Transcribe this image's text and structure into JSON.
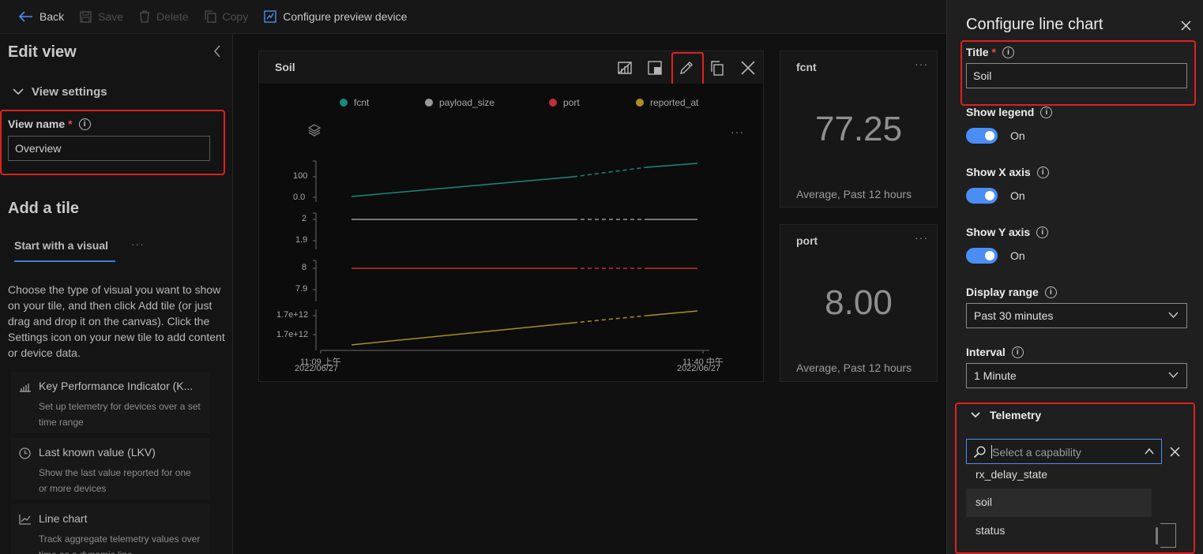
{
  "toolbar": {
    "back": "Back",
    "save": "Save",
    "delete": "Delete",
    "copy": "Copy",
    "configure": "Configure preview device"
  },
  "left_panel": {
    "title": "Edit view",
    "view_settings": "View settings",
    "view_name_label": "View name",
    "view_name_value": "Overview",
    "add_tile_title": "Add a tile",
    "tab_label": "Start with a visual",
    "tab_more": "···",
    "description": "Choose the type of visual you want to show on your tile, and then click Add tile (or just drag and drop it on the canvas). Click the Settings icon on your new tile to add content or device data.",
    "tiles": [
      {
        "title": "Key Performance Indicator (K...",
        "desc": "Set up telemetry for devices over a set time range",
        "icon": "kpi-icon"
      },
      {
        "title": "Last known value (LKV)",
        "desc": "Show the last value reported for one or more devices",
        "icon": "clock-icon"
      },
      {
        "title": "Line chart",
        "desc": "Track aggregate telemetry values over time as a dynamic line",
        "icon": "line-chart-icon"
      }
    ]
  },
  "chart_tile": {
    "title": "Soil",
    "more": "···"
  },
  "chart_data": {
    "type": "line",
    "title": "Soil",
    "legend_position": "top",
    "x_start": {
      "time": "11:09 上午",
      "date": "2022/06/27"
    },
    "x_end": {
      "time": "11:40 中午",
      "date": "2022/06/27"
    },
    "series": [
      {
        "name": "fcnt",
        "color": "#1a8a7a",
        "y_ticks": [
          "100",
          "0.0"
        ],
        "start": 0.0,
        "end": 120,
        "trend": "rising"
      },
      {
        "name": "payload_size",
        "color": "#9a9a9a",
        "y_ticks": [
          "2",
          "1.9"
        ],
        "start": 2,
        "end": 2,
        "trend": "flat"
      },
      {
        "name": "port",
        "color": "#c0303a",
        "y_ticks": [
          "8",
          "7.9"
        ],
        "start": 8,
        "end": 8,
        "trend": "flat"
      },
      {
        "name": "reported_at",
        "color": "#a89020",
        "y_ticks": [
          "1.7e+12",
          "1.7e+12"
        ],
        "start": 1700000000000.0,
        "end": 1700000000000.0,
        "trend": "rising"
      }
    ]
  },
  "kpis": [
    {
      "title": "fcnt",
      "value": "77.25",
      "sub": "Average, Past 12 hours",
      "more": "···"
    },
    {
      "title": "port",
      "value": "8.00",
      "sub": "Average, Past 12 hours",
      "more": "···"
    }
  ],
  "right_panel": {
    "title": "Configure line chart",
    "title_label": "Title",
    "title_value": "Soil",
    "show_legend": "Show legend",
    "show_x_axis": "Show X axis",
    "show_y_axis": "Show Y axis",
    "toggle_on": "On",
    "display_range_label": "Display range",
    "display_range_value": "Past 30 minutes",
    "interval_label": "Interval",
    "interval_value": "1 Minute",
    "telemetry_label": "Telemetry",
    "search_placeholder": "Select a capability",
    "dropdown_items": [
      "rx_delay_state",
      "soil",
      "status"
    ],
    "accent_color": "#4a8ef5",
    "highlight_color": "#e02020"
  }
}
